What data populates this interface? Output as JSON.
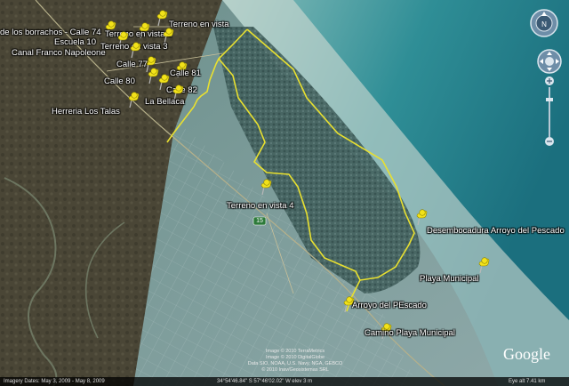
{
  "placemarks": [
    {
      "label": "Terreno en vista"
    },
    {
      "label": "de los borrachos - Calle 74"
    },
    {
      "label": "Terreno en vista 2"
    },
    {
      "label": "Escuela 10"
    },
    {
      "label": "Terreno en vista 3"
    },
    {
      "label": "Canal Franco Napoleone"
    },
    {
      "label": "Calle 77"
    },
    {
      "label": "Calle 81"
    },
    {
      "label": "Calle 80"
    },
    {
      "label": "Calle 82"
    },
    {
      "label": "La Bellaca"
    },
    {
      "label": "Herreria Los Talas"
    },
    {
      "label": "Terreno en vista 4"
    },
    {
      "label": "Desembocadura Arroyo del Pescado"
    },
    {
      "label": "Playa Municipal"
    },
    {
      "label": "Arroyo del PEscado"
    },
    {
      "label": "Camino Playa Municipal"
    }
  ],
  "road_shield": "15",
  "status": {
    "imagery_dates": "Imagery Dates: May 3, 2009 - May 8, 2009",
    "coordinates": "34°54'46.84\" S   57°46'02.02\" W   elev 3 m",
    "eye_alt": "Eye alt   7.41 km"
  },
  "copyright": [
    "Image © 2010 TerraMetrics",
    "Image © 2010 DigitalGlobe",
    "Data SIO, NOAA, U.S. Navy, NGA, GEBCO",
    "© 2010 Inav/Geosistemas SRL"
  ],
  "logo": "Google",
  "colors": {
    "boundary": "#e8e030",
    "pin": "#f2e21a"
  },
  "icons": [
    "look-around-icon",
    "move-pan-icon",
    "zoom-in-icon",
    "zoom-out-icon",
    "placemark-pin-icon"
  ]
}
